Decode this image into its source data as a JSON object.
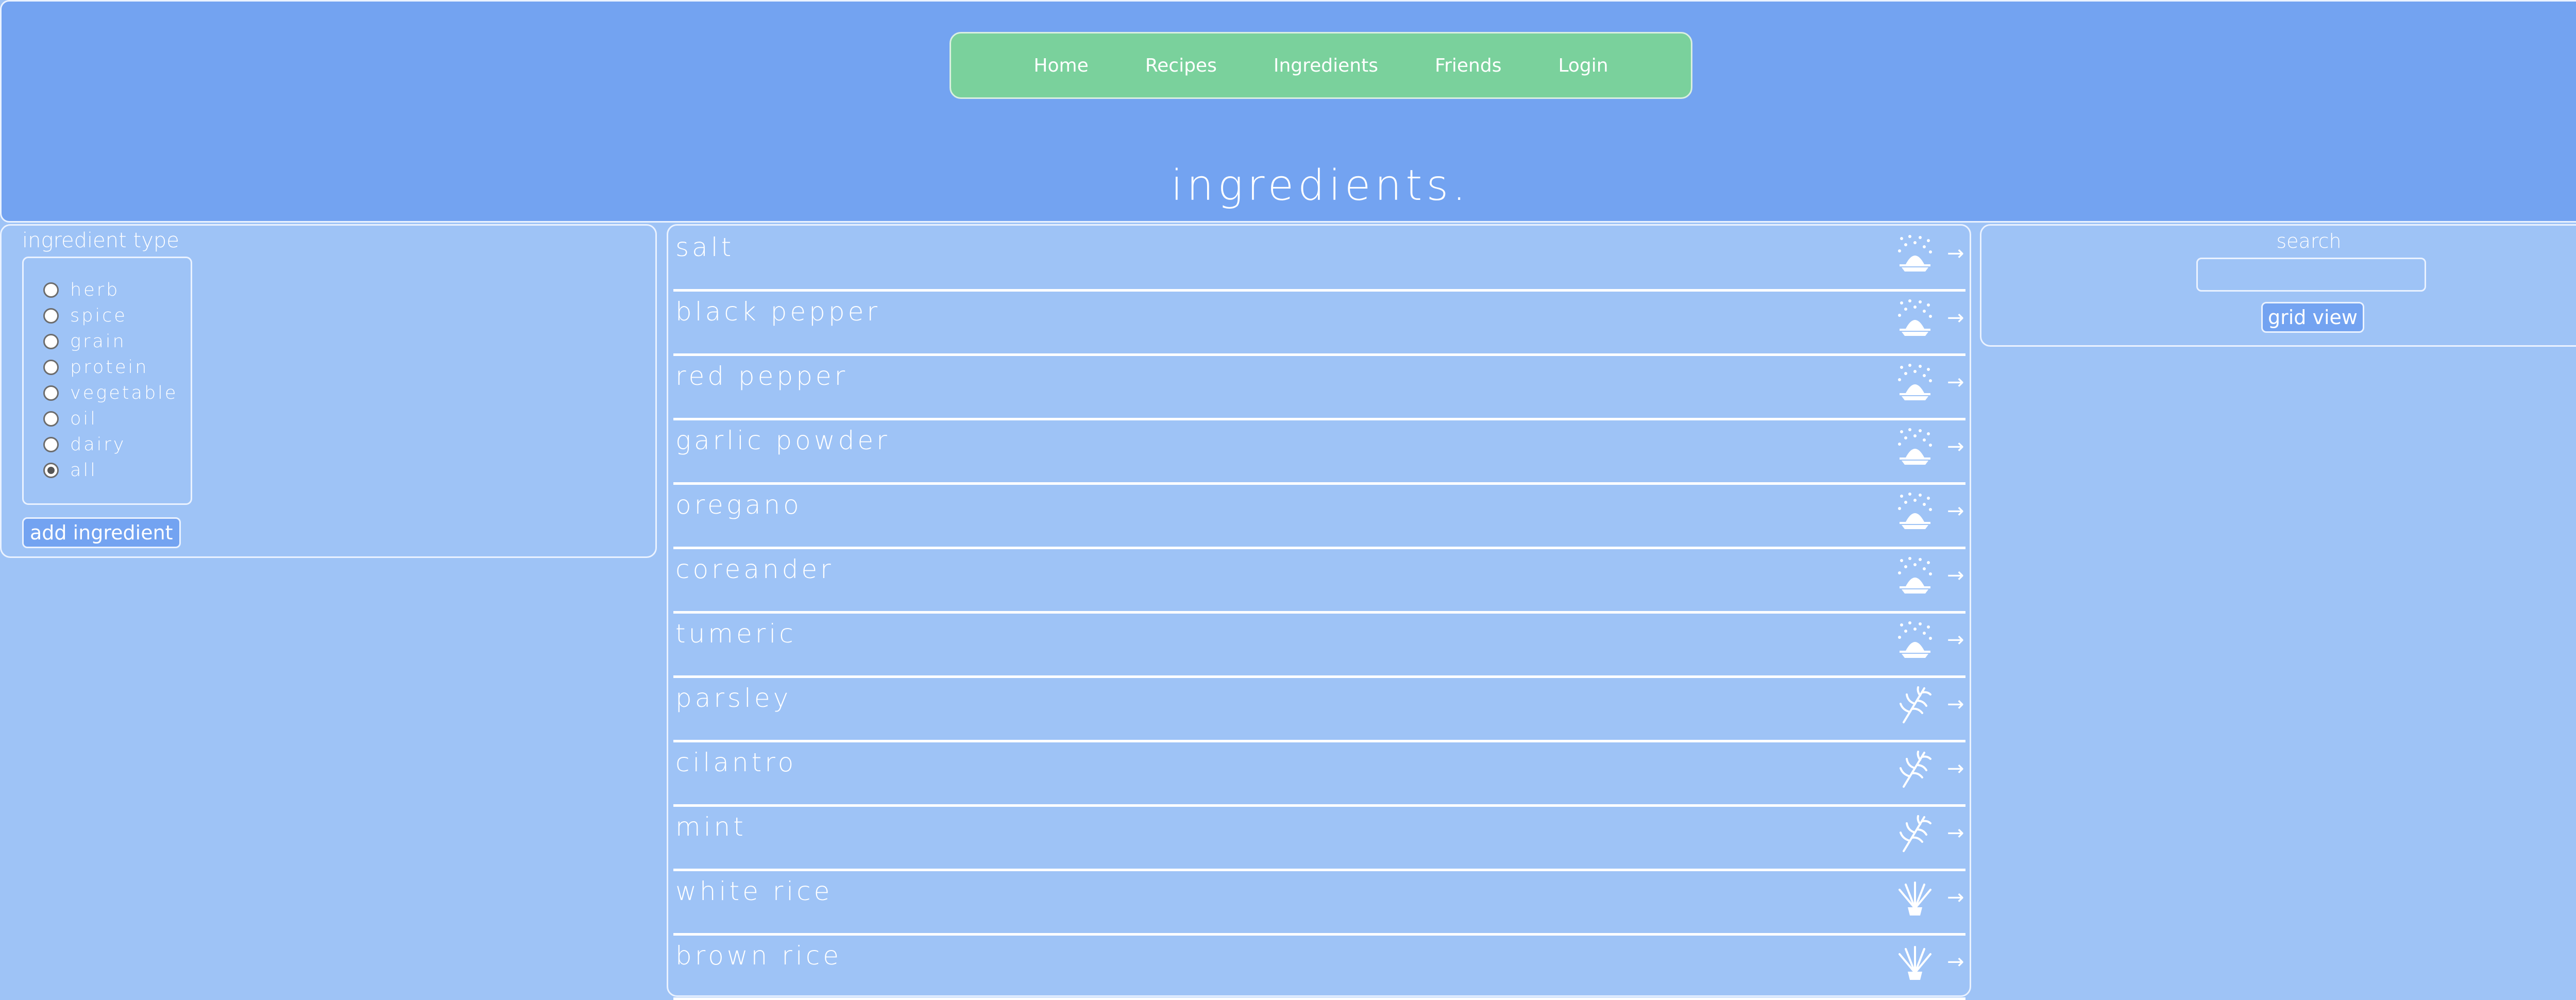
{
  "nav": {
    "items": [
      {
        "label": "Home"
      },
      {
        "label": "Recipes"
      },
      {
        "label": "Ingredients"
      },
      {
        "label": "Friends"
      },
      {
        "label": "Login"
      }
    ]
  },
  "page_title": "ingredients.",
  "filter": {
    "legend": "ingredient type",
    "options": [
      {
        "label": "herb",
        "checked": false
      },
      {
        "label": "spice",
        "checked": false
      },
      {
        "label": "grain",
        "checked": false
      },
      {
        "label": "protein",
        "checked": false
      },
      {
        "label": "vegetable",
        "checked": false
      },
      {
        "label": "oil",
        "checked": false
      },
      {
        "label": "dairy",
        "checked": false
      },
      {
        "label": "all",
        "checked": true
      }
    ],
    "add_button": "add ingredient"
  },
  "ingredients": [
    {
      "name": "salt",
      "icon": "spice-icon"
    },
    {
      "name": "black pepper",
      "icon": "spice-icon"
    },
    {
      "name": "red pepper",
      "icon": "spice-icon"
    },
    {
      "name": "garlic powder",
      "icon": "spice-icon"
    },
    {
      "name": "oregano",
      "icon": "spice-icon"
    },
    {
      "name": "coreander",
      "icon": "spice-icon"
    },
    {
      "name": "tumeric",
      "icon": "spice-icon"
    },
    {
      "name": "parsley",
      "icon": "herb-icon"
    },
    {
      "name": "cilantro",
      "icon": "herb-icon"
    },
    {
      "name": "mint",
      "icon": "herb-icon"
    },
    {
      "name": "white rice",
      "icon": "grain-icon"
    },
    {
      "name": "brown rice",
      "icon": "grain-icon"
    }
  ],
  "search": {
    "label": "search",
    "value": "",
    "placeholder": "",
    "grid_button": "grid view"
  },
  "colors": {
    "header_bg": "#73a3f1",
    "page_bg": "#9ec3f6",
    "nav_bg": "#7ad19c",
    "border": "#eaf2ff"
  }
}
